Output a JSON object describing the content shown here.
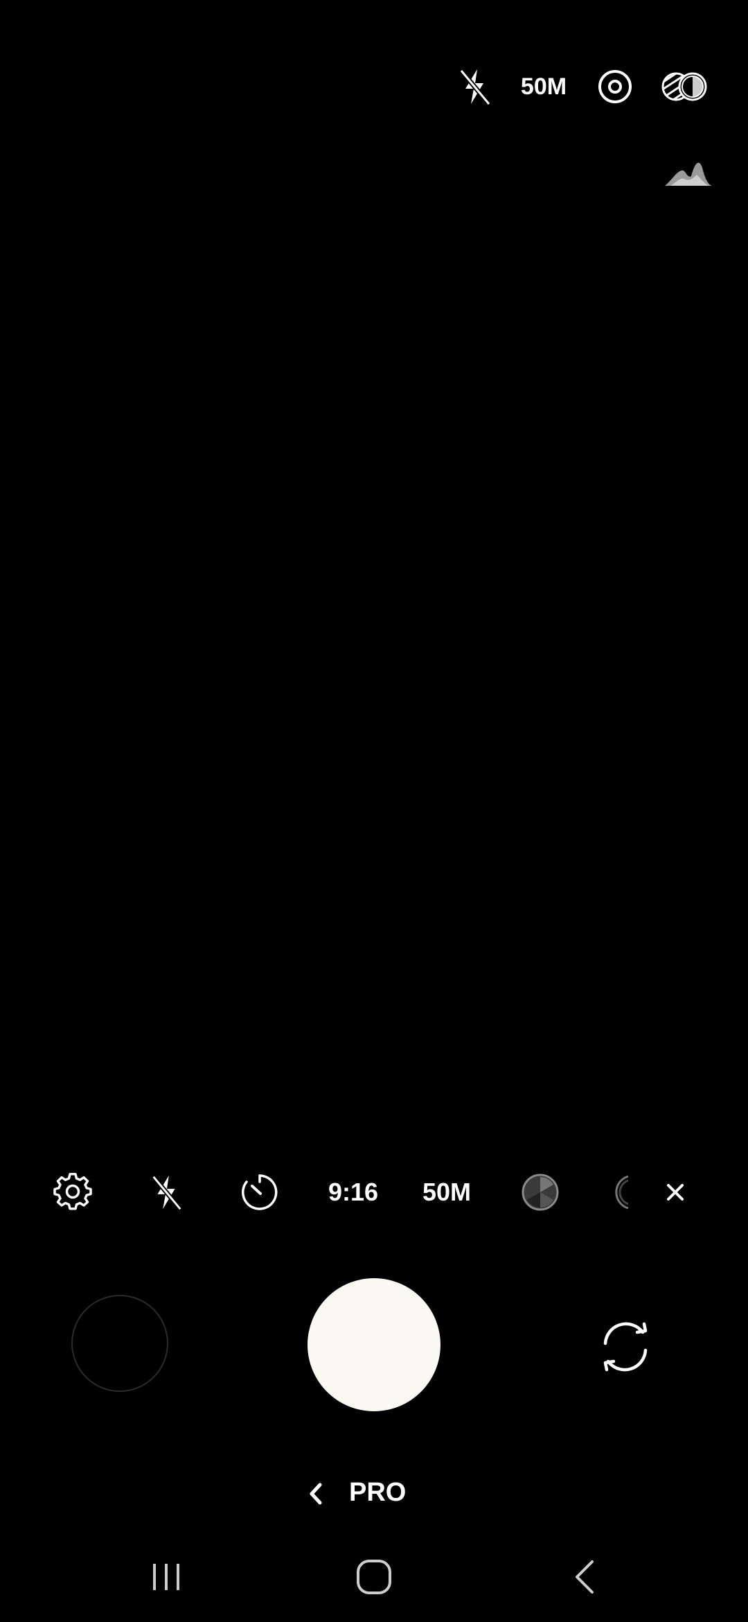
{
  "top_bar": {
    "flash_icon": "flash-off-icon",
    "resolution": "50M",
    "focus_icon": "lens-icon",
    "filter_icon": "filters-icon"
  },
  "histogram_icon": "histogram-icon",
  "quick_settings": {
    "settings_icon": "gear-icon",
    "flash_icon": "flash-off-icon",
    "timer_icon": "timer-icon",
    "aspect_ratio": "9:16",
    "resolution": "50M",
    "filter_icon": "filter-icon",
    "partial_icon": "more-icon",
    "close_icon": "close-icon"
  },
  "shutter": {
    "gallery_icon": "gallery-thumbnail",
    "shutter_button": "shutter-button",
    "switch_icon": "switch-camera-icon"
  },
  "mode": {
    "back_icon": "chevron-left-icon",
    "label": "PRO"
  },
  "navbar": {
    "recents_icon": "recents-icon",
    "home_icon": "home-icon",
    "back_icon": "back-icon"
  },
  "colors": {
    "background": "#000000",
    "shutter": "#f9f8f3",
    "icon": "#ffffff"
  }
}
